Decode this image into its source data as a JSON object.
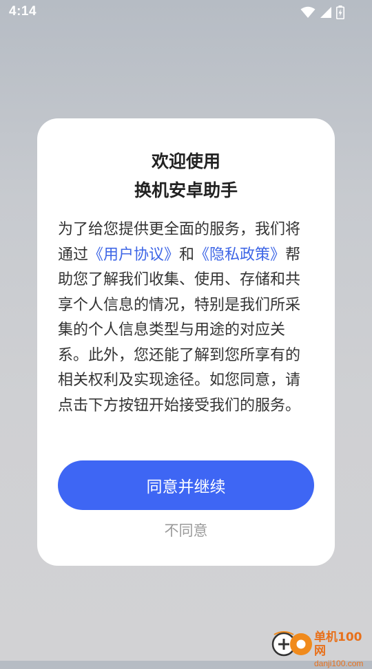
{
  "status_bar": {
    "time": "4:14",
    "icons": [
      "wifi-icon",
      "cellular-signal-icon",
      "battery-charging-icon"
    ]
  },
  "dialog": {
    "title_line1": "欢迎使用",
    "title_line2": "换机安卓助手",
    "body_segments": {
      "intro": "为了给您提供更全面的服务，我们将通过",
      "user_agreement_link": "《用户协议》",
      "and": "和",
      "privacy_policy_link": "《隐私政策》",
      "rest": "帮助您了解我们收集、使用、存储和共享个人信息的情况，特别是我们所采集的个人信息类型与用途的对应关系。此外，您还能了解到您所享有的相关权利及实现途径。如您同意，请点击下方按钮开始接受我们的服务。"
    },
    "agree_button_label": "同意并继续",
    "disagree_button_label": "不同意"
  },
  "watermark": {
    "name": "单机100网",
    "url": "danji100.com"
  },
  "colors": {
    "accent": "#3e66f4",
    "link": "#3e66e6",
    "muted": "#9a9a9a",
    "watermark": "#e8701a"
  }
}
